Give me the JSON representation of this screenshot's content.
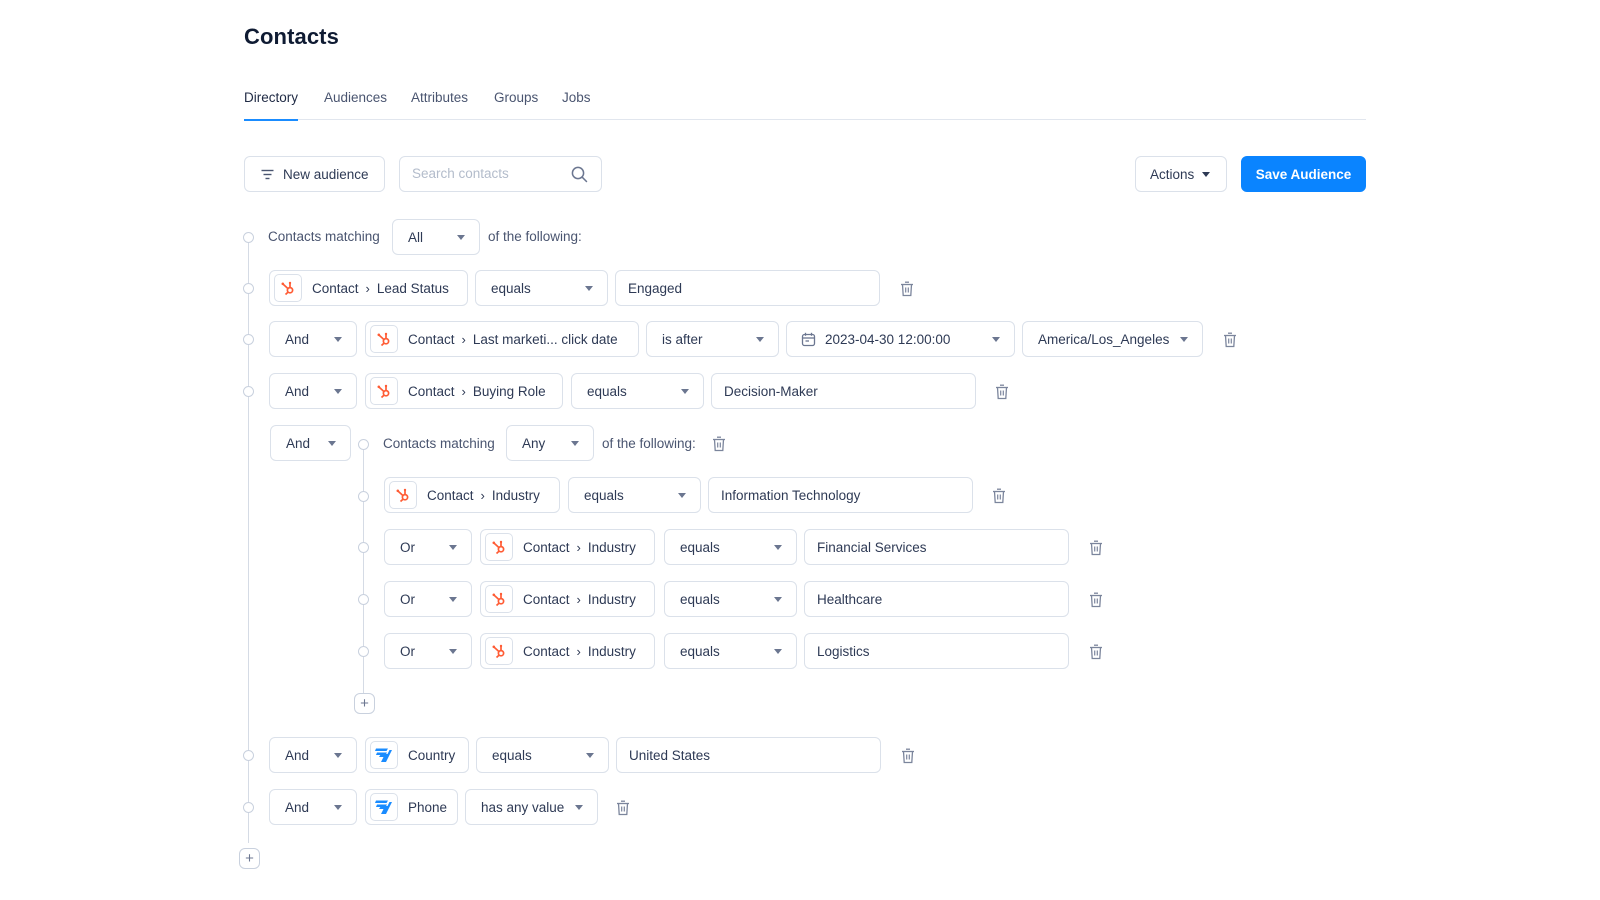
{
  "page": {
    "title": "Contacts"
  },
  "tabs": [
    {
      "label": "Directory",
      "active": true
    },
    {
      "label": "Audiences",
      "active": false
    },
    {
      "label": "Attributes",
      "active": false
    },
    {
      "label": "Groups",
      "active": false
    },
    {
      "label": "Jobs",
      "active": false
    }
  ],
  "toolbar": {
    "new_audience_label": "New audience",
    "new_audience_icon": "filter-lines-icon",
    "search_placeholder": "Search contacts",
    "search_value": "",
    "search_icon": "search-icon",
    "actions_label": "Actions",
    "save_label": "Save Audience"
  },
  "colors": {
    "accent": "#0a84ff",
    "hubspot": "#ff5c35",
    "source_blue": "#1a8cff",
    "border": "#dbe1ea"
  },
  "root_group": {
    "prefix": "Contacts matching",
    "match": "All",
    "suffix": "of the following:",
    "conditions": [
      {
        "connector": null,
        "source": "hubspot",
        "object": "Contact",
        "property": "Lead Status",
        "operator": "equals",
        "value": "Engaged"
      },
      {
        "connector": "And",
        "source": "hubspot",
        "object": "Contact",
        "property": "Last marketi... click date",
        "operator": "is after",
        "value": "2023-04-30 12:00:00",
        "value_icon": "calendar-icon",
        "timezone": "America/Los_Angeles"
      },
      {
        "connector": "And",
        "source": "hubspot",
        "object": "Contact",
        "property": "Buying Role",
        "operator": "equals",
        "value": "Decision-Maker"
      }
    ],
    "nested_group": {
      "connector": "And",
      "prefix": "Contacts matching",
      "match": "Any",
      "suffix": "of the following:",
      "conditions": [
        {
          "connector": null,
          "source": "hubspot",
          "object": "Contact",
          "property": "Industry",
          "operator": "equals",
          "value": "Information Technology"
        },
        {
          "connector": "Or",
          "source": "hubspot",
          "object": "Contact",
          "property": "Industry",
          "operator": "equals",
          "value": "Financial Services"
        },
        {
          "connector": "Or",
          "source": "hubspot",
          "object": "Contact",
          "property": "Industry",
          "operator": "equals",
          "value": "Healthcare"
        },
        {
          "connector": "Or",
          "source": "hubspot",
          "object": "Contact",
          "property": "Industry",
          "operator": "equals",
          "value": "Logistics"
        }
      ]
    },
    "trailing_conditions": [
      {
        "connector": "And",
        "source": "internal",
        "property": "Country",
        "operator": "equals",
        "value": "United States"
      },
      {
        "connector": "And",
        "source": "internal",
        "property": "Phone",
        "operator": "has any value"
      }
    ]
  }
}
